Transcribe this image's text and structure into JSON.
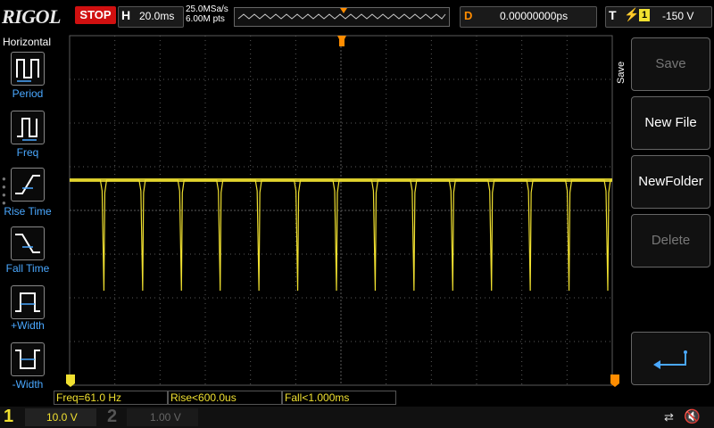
{
  "brand": "RIGOL",
  "run_state": "STOP",
  "horizontal": {
    "letter": "H",
    "time_base": "20.0ms",
    "sample_rate": "25.0MSa/s",
    "memory_depth": "6.00M pts"
  },
  "delay": {
    "letter": "D",
    "value": "0.00000000ps"
  },
  "trigger": {
    "letter": "T",
    "source": "1",
    "level": "-150 V"
  },
  "left_menu": {
    "title": "Horizontal",
    "items": [
      {
        "label": "Period",
        "icon": "period-icon"
      },
      {
        "label": "Freq",
        "icon": "freq-icon"
      },
      {
        "label": "Rise Time",
        "icon": "rise-time-icon"
      },
      {
        "label": "Fall Time",
        "icon": "fall-time-icon"
      },
      {
        "label": "+Width",
        "icon": "pos-width-icon"
      },
      {
        "label": "-Width",
        "icon": "neg-width-icon"
      }
    ]
  },
  "right_menu": {
    "title": "Save",
    "buttons": [
      {
        "label": "Save",
        "enabled": false
      },
      {
        "label": "New File",
        "enabled": true
      },
      {
        "label": "NewFolder",
        "enabled": true
      },
      {
        "label": "Delete",
        "enabled": false
      },
      {
        "label": "",
        "icon": "enter-return-icon",
        "enabled": true
      }
    ]
  },
  "measurements": [
    "Freq=61.0 Hz",
    "Rise<600.0us",
    "Fall<1.000ms"
  ],
  "channels": [
    {
      "number": "1",
      "scale": "10.0 V",
      "active": true
    },
    {
      "number": "2",
      "scale": "1.00 V",
      "active": false
    }
  ],
  "status_icons": [
    "usb-icon",
    "speaker-mute-icon"
  ],
  "colors": {
    "trace": "#f0e030",
    "stop": "#d01010",
    "delay": "#ff8c00",
    "menu_label": "#4aa8ff",
    "grid": "#5a5a5a"
  },
  "waveform": {
    "high_level": "approx 0 V",
    "pulse_count_visible": 14,
    "frequency": "61.0 Hz"
  }
}
